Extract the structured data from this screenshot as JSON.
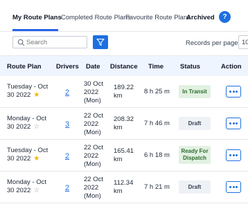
{
  "tabs": [
    {
      "label": "My Route Plans"
    },
    {
      "label": "Completed Route Plans"
    },
    {
      "label": "Favourite Route Plans"
    },
    {
      "label": "Archived"
    }
  ],
  "help_label": "?",
  "toolbar": {
    "search_placeholder": "Search",
    "records_label": "Records per page",
    "records_value": "10"
  },
  "table": {
    "headers": [
      "Route Plan",
      "Drivers",
      "Date",
      "Distance",
      "Time",
      "Status",
      "Action"
    ],
    "rows": [
      {
        "plan_line1": "Tuesday - Oct",
        "plan_line2": "30 2022",
        "favourite": true,
        "drivers": "2",
        "date_line1": "30 Oct",
        "date_line2": "2022",
        "date_line3": "(Mon)",
        "distance_line1": "189.22",
        "distance_line2": "km",
        "time": "8 h 25 m",
        "status_line1": "In Transit",
        "status_line2": ""
      },
      {
        "plan_line1": "Monday - Oct",
        "plan_line2": "30 2022",
        "favourite": false,
        "drivers": "3",
        "date_line1": "22 Oct",
        "date_line2": "2022",
        "date_line3": "(Mon)",
        "distance_line1": "208.32",
        "distance_line2": "km",
        "time": "7 h 46 m",
        "status_line1": "Draft",
        "status_line2": ""
      },
      {
        "plan_line1": "Tuesday - Oct",
        "plan_line2": "30 2022",
        "favourite": true,
        "drivers": "2",
        "date_line1": "22 Oct",
        "date_line2": "2022",
        "date_line3": "(Mon)",
        "distance_line1": "165.41",
        "distance_line2": "km",
        "time": "6 h 18 m",
        "status_line1": "Ready For",
        "status_line2": "Dispatch"
      },
      {
        "plan_line1": "Monday - Oct",
        "plan_line2": "30 2022",
        "favourite": false,
        "drivers": "2",
        "date_line1": "22 Oct",
        "date_line2": "2022",
        "date_line3": "(Mon)",
        "distance_line1": "112.34",
        "distance_line2": "km",
        "time": "7 h 21 m",
        "status_line1": "Draft",
        "status_line2": ""
      }
    ]
  },
  "colors": {
    "accent": "#1d6fe0",
    "favourite_star": "#f5b301",
    "status_green_bg": "#e2f1e2"
  },
  "icons": {
    "search": "search-icon",
    "filter": "filter-icon",
    "favourite": "star-icon",
    "action": "more-horizontal-icon"
  }
}
